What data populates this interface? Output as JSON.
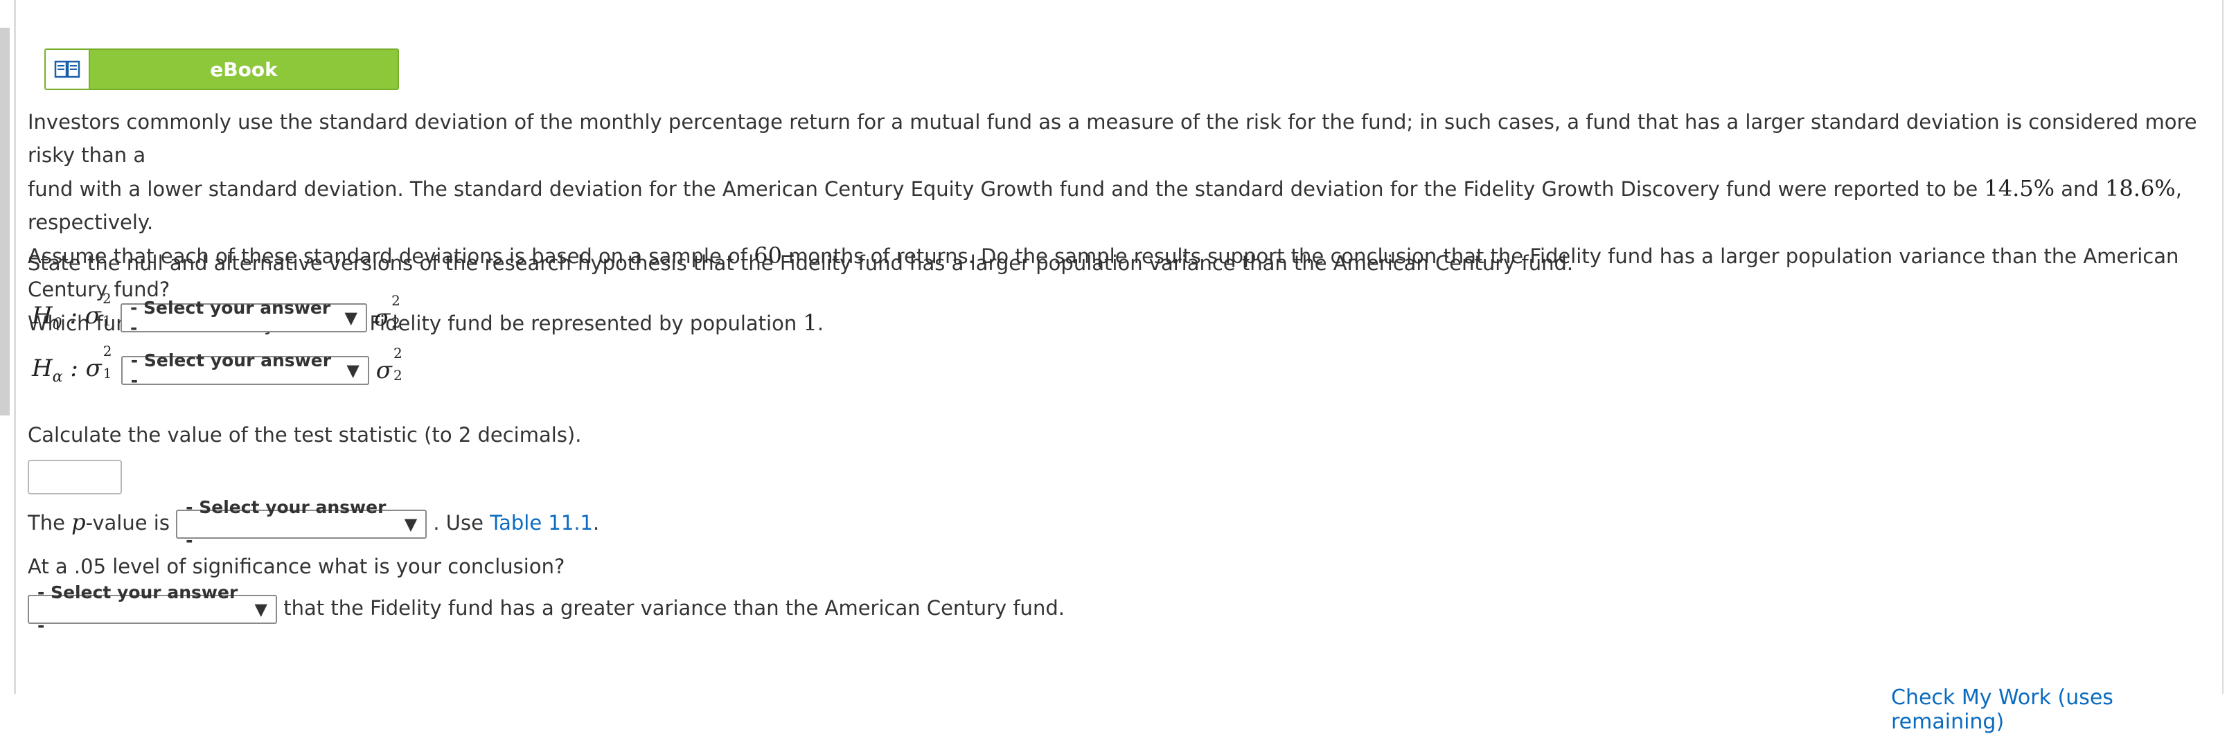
{
  "ebook": {
    "label": "eBook",
    "icon": "book-icon",
    "button_color": "#8cc83a"
  },
  "problem": {
    "p1_a": "Investors commonly use the standard deviation of the monthly percentage return for a mutual fund as a measure of the risk for the fund; in such cases, a fund that has a larger standard deviation is considered more risky than a",
    "p1_b": "fund with a lower standard deviation. The standard deviation for the American Century Equity Growth fund and the standard deviation for the Fidelity Growth Discovery fund were reported to be",
    "val1": "14.5%",
    "and": "and",
    "val2": "18.6%",
    "resp": ", respectively.",
    "p1_c": "Assume that each of these standard deviations is based on a sample of",
    "n": "60",
    "p1_d": "months of returns. Do the sample results support the conclusion that the Fidelity fund has a larger population variance than the American Century fund?",
    "p1_e": "Which fund is more risky? Let the Fidelity fund be represented by population",
    "pop": "1",
    "period": "."
  },
  "hypothesis": {
    "instruction": "State the null and alternative versions of the research hypothesis that the Fidelity fund has a larger population variance than the American Century fund.",
    "h0_select": "- Select your answer -",
    "ha_select": "- Select your answer -"
  },
  "test_stat": {
    "instruction": "Calculate the value of the test statistic (to 2 decimals).",
    "value": ""
  },
  "pvalue": {
    "prefix": "The",
    "p": "p",
    "mid": "-value is",
    "select": "- Select your answer -",
    "use": ". Use",
    "link": "Table 11.1",
    "end": "."
  },
  "conclusion": {
    "question": "At a .05 level of significance what is your conclusion?",
    "select": "- Select your answer -",
    "suffix": "that the Fidelity fund has a greater variance than the American Century fund."
  },
  "footer": {
    "link": "Check My Work (uses remaining)"
  }
}
